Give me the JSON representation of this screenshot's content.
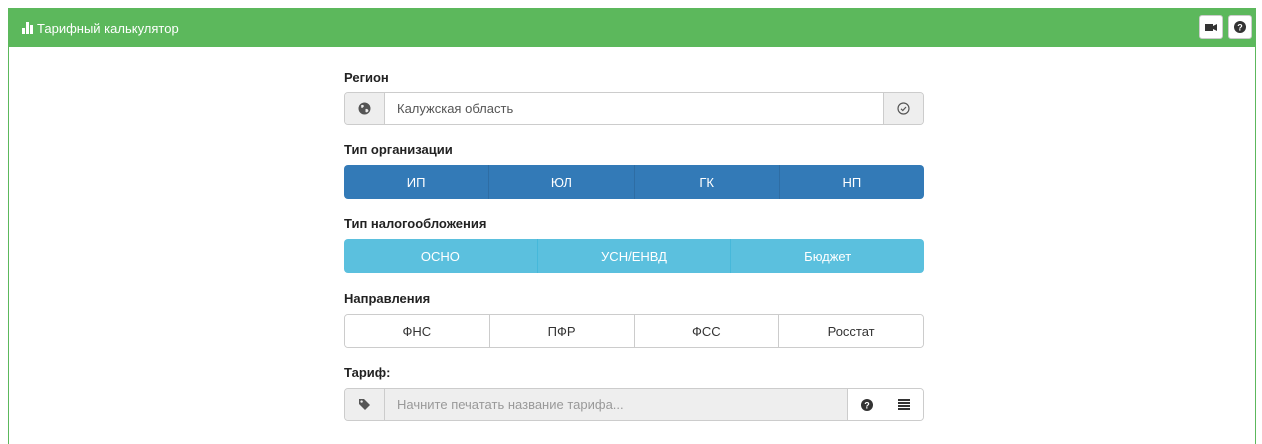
{
  "header": {
    "title": "Тарифный калькулятор",
    "icon": "bar-chart-icon",
    "buttons": [
      {
        "name": "video-icon"
      },
      {
        "name": "help-icon"
      }
    ],
    "color": "#5cb85c"
  },
  "region": {
    "label": "Регион",
    "value": "Калужская область",
    "left_icon": "globe-icon",
    "right_icon": "check-circle-icon"
  },
  "org_type": {
    "label": "Тип организации",
    "options": [
      "ИП",
      "ЮЛ",
      "ГК",
      "НП"
    ],
    "color": "#337ab7"
  },
  "tax_type": {
    "label": "Тип налогообложения",
    "options": [
      "ОСНО",
      "УСН/ЕНВД",
      "Бюджет"
    ],
    "color": "#5bc0de"
  },
  "directions": {
    "label": "Направления",
    "options": [
      "ФНС",
      "ПФР",
      "ФСС",
      "Росстат"
    ]
  },
  "tariff": {
    "label": "Тариф:",
    "placeholder": "Начните печатать название тарифа...",
    "left_icon": "tag-icon",
    "right_icons": [
      "help-icon",
      "list-icon"
    ]
  }
}
